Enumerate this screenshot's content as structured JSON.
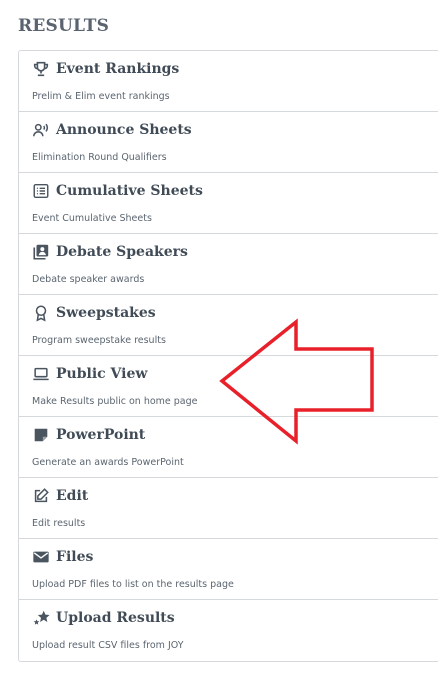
{
  "page": {
    "title": "RESULTS"
  },
  "menu": {
    "items": [
      {
        "icon": "trophy-icon",
        "title": "Event Rankings",
        "desc": "Prelim & Elim event rankings"
      },
      {
        "icon": "announce-icon",
        "title": "Announce Sheets",
        "desc": "Elimination Round Qualifiers"
      },
      {
        "icon": "list-icon",
        "title": "Cumulative Sheets",
        "desc": "Event Cumulative Sheets"
      },
      {
        "icon": "speaker-icon",
        "title": "Debate Speakers",
        "desc": "Debate speaker awards"
      },
      {
        "icon": "award-icon",
        "title": "Sweepstakes",
        "desc": "Program sweepstake results"
      },
      {
        "icon": "laptop-icon",
        "title": "Public View",
        "desc": "Make Results public on home page"
      },
      {
        "icon": "note-icon",
        "title": "PowerPoint",
        "desc": "Generate an awards PowerPoint"
      },
      {
        "icon": "edit-icon",
        "title": "Edit",
        "desc": "Edit results"
      },
      {
        "icon": "envelope-icon",
        "title": "Files",
        "desc": "Upload PDF files to list on the results page"
      },
      {
        "icon": "stars-icon",
        "title": "Upload Results",
        "desc": "Upload result CSV files from JOY"
      }
    ]
  },
  "annotation": {
    "arrow_color": "#e8202a",
    "points_to": "Public View"
  }
}
